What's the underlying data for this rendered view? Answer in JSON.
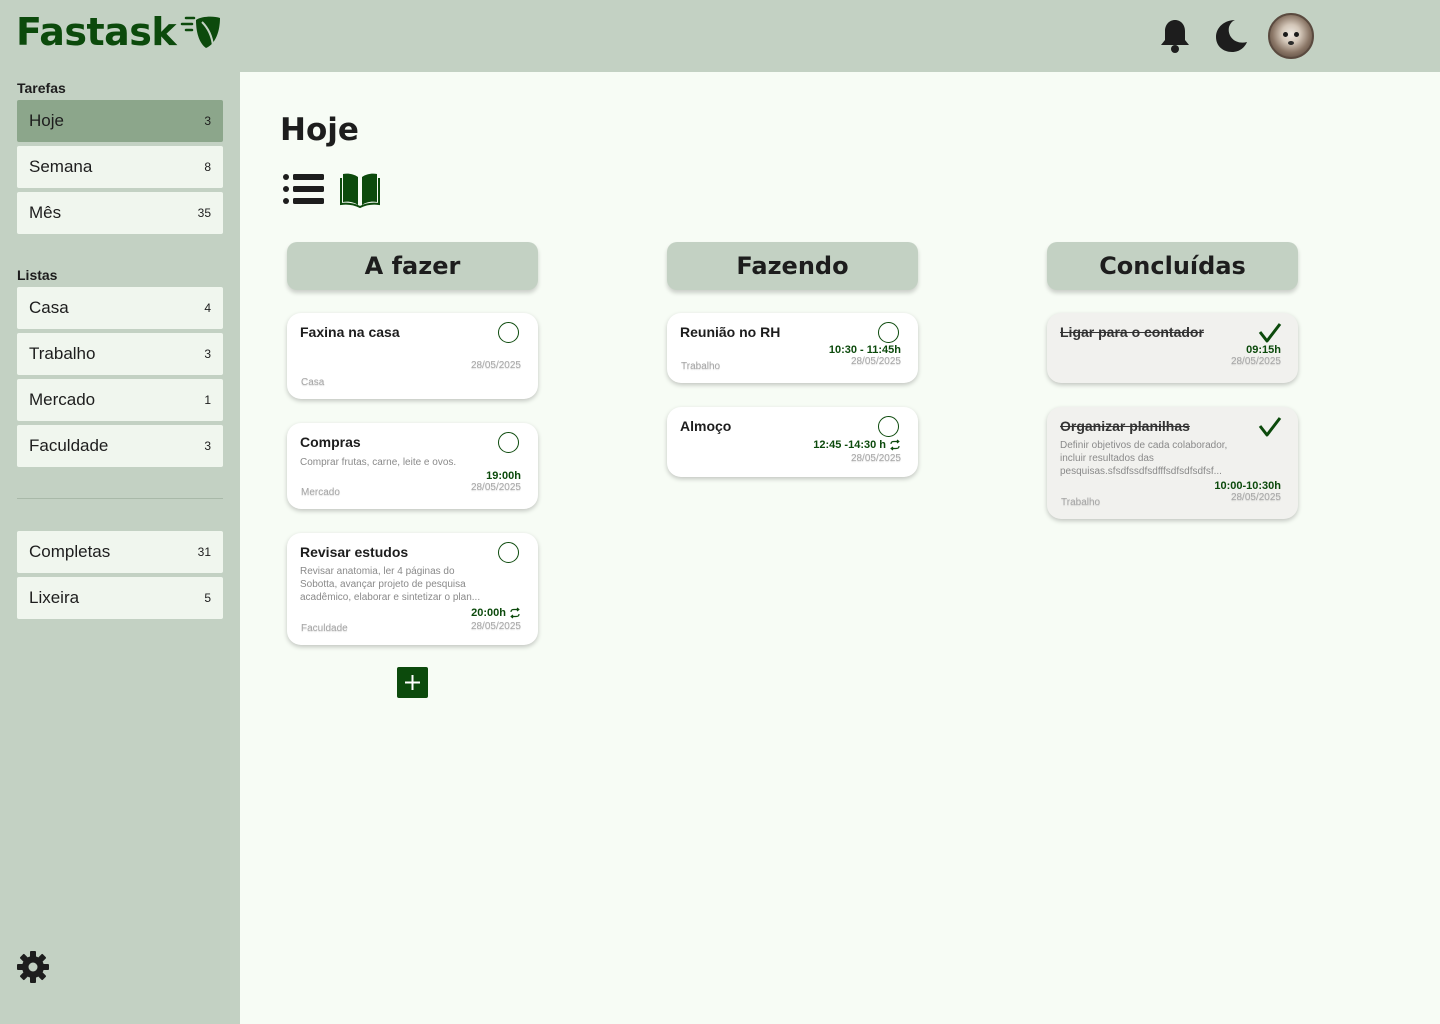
{
  "app": {
    "name": "Fastask"
  },
  "topbar": {
    "icons": [
      "bell-icon",
      "moon-icon",
      "avatar"
    ]
  },
  "sidebar": {
    "tasks_title": "Tarefas",
    "tasks": [
      {
        "label": "Hoje",
        "count": "3",
        "active": true
      },
      {
        "label": "Semana",
        "count": "8"
      },
      {
        "label": "Mês",
        "count": "35"
      }
    ],
    "lists_title": "Listas",
    "lists": [
      {
        "label": "Casa",
        "count": "4"
      },
      {
        "label": "Trabalho",
        "count": "3"
      },
      {
        "label": "Mercado",
        "count": "1"
      },
      {
        "label": "Faculdade",
        "count": "3"
      }
    ],
    "extra": [
      {
        "label": "Completas",
        "count": "31"
      },
      {
        "label": "Lixeira",
        "count": "5"
      }
    ]
  },
  "main": {
    "title": "Hoje",
    "views": [
      "list-view-icon",
      "board-view-icon"
    ],
    "columns": [
      {
        "title": "A fazer",
        "cards": [
          {
            "title": "Faxina na casa",
            "desc": "",
            "time": "",
            "date": "28/05/2025",
            "list": "Casa"
          },
          {
            "title": "Compras",
            "desc": "Comprar frutas, carne, leite e ovos.",
            "time": "19:00h",
            "date": "28/05/2025",
            "list": "Mercado"
          },
          {
            "title": "Revisar estudos",
            "desc": "Revisar anatomia, ler  4 páginas do Sobotta, avançar projeto de pesquisa acadêmico, elaborar e sintetizar o plan...",
            "time": "20:00h",
            "date": "28/05/2025",
            "list": "Faculdade",
            "repeat": true
          }
        ]
      },
      {
        "title": "Fazendo",
        "cards": [
          {
            "title": "Reunião no RH",
            "time": "10:30 - 11:45h",
            "date": "28/05/2025",
            "list": "Trabalho"
          },
          {
            "title": "Almoço",
            "time": "12:45 -14:30 h",
            "date": "28/05/2025",
            "list": "",
            "repeat": true
          }
        ]
      },
      {
        "title": "Concluídas",
        "cards": [
          {
            "title": "Ligar para o contador",
            "time": "09:15h",
            "date": "28/05/2025",
            "list": ""
          },
          {
            "title": "Organizar planilhas",
            "desc": "Definir objetivos de cada colaborador, incluir resultados das pesquisas.sfsdfssdfsdfffsdfsdfsdfsf...",
            "time": "10:00-10:30h",
            "date": "28/05/2025",
            "list": "Trabalho"
          }
        ]
      }
    ]
  },
  "colors": {
    "accent": "#0c4a0c",
    "sidebar": "#c3d1c3",
    "active": "#8ca68b",
    "background": "#f7fcf5"
  }
}
